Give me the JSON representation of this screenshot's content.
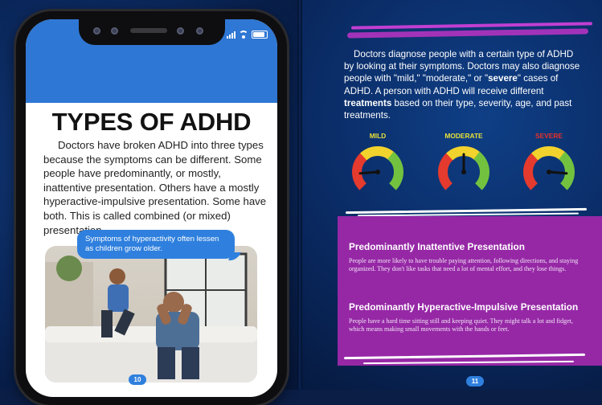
{
  "left_page": {
    "title": "TYPES OF ADHD",
    "body": "Doctors have broken ADHD into three types because the symptoms can be different. Some people have predominantly, or mostly, inattentive presentation. Others have a mostly hyperactive-impulsive presentation. Some have both. This is called combined (or mixed) presentation.",
    "bubble": "Symptoms of hyperactivity often lessen as children grow older.",
    "page_number": "10"
  },
  "right_page": {
    "intro_parts": [
      "Doctors diagnose people with a certain type of ADHD by looking at their symptoms. Doctors may also diagnose people with \"mild,\" \"moderate,\" or \"",
      "severe",
      "\" cases of ADHD. A person with ADHD will receive different ",
      "treatments",
      " based on their type, severity, age, and past treatments."
    ],
    "gauges": [
      {
        "label": "MILD",
        "color": "#e8e23a",
        "level": 0.15
      },
      {
        "label": "MODERATE",
        "color": "#e8e23a",
        "level": 0.5
      },
      {
        "label": "SEVERE",
        "color": "#e8302a",
        "level": 0.85
      }
    ],
    "sections": [
      {
        "heading": "Predominantly Inattentive Presentation",
        "text": "People are more likely to have trouble paying attention, following directions, and staying organized. They don't like tasks that need a lot of mental effort, and they lose things."
      },
      {
        "heading": "Predominantly Hyperactive-Impulsive Presentation",
        "text": "People have a hard time sitting still and keeping quiet. They might talk a lot and fidget, which means making small movements with the hands or feet."
      }
    ],
    "page_number": "11"
  },
  "colors": {
    "phone_header": "#2f77d4",
    "bubble": "#2f80de",
    "panel": "#9628a6",
    "accent_magenta": "#b43bc8",
    "gauge_red": "#e53a2e",
    "gauge_yellow": "#f2d22c",
    "gauge_green": "#73c23f"
  },
  "icons": [
    "signal-icon",
    "wifi-icon",
    "battery-icon"
  ]
}
